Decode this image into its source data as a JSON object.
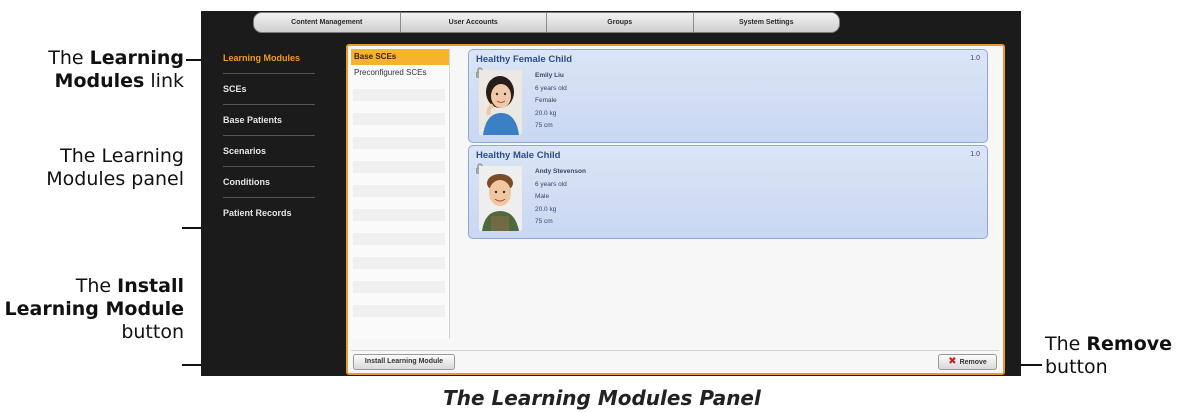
{
  "callouts": {
    "learning_modules_link": {
      "pre": "The ",
      "bold": "Learning Modules",
      "post": " link"
    },
    "learning_modules_panel": {
      "line1": "The Learning",
      "line2": "Modules panel"
    },
    "install_button": {
      "pre": "The ",
      "bold": "Install Learning Module",
      "post": " button"
    },
    "remove_button": {
      "pre": "The ",
      "bold": "Remove",
      "post": "button"
    }
  },
  "caption": "The Learning Modules Panel",
  "app": {
    "tabs": [
      "Content Management",
      "User Accounts",
      "Groups",
      "System Settings"
    ],
    "sidebar": {
      "items": [
        {
          "label": "Learning Modules",
          "active": true
        },
        {
          "label": "SCEs",
          "active": false
        },
        {
          "label": "Base Patients",
          "active": false
        },
        {
          "label": "Scenarios",
          "active": false
        },
        {
          "label": "Conditions",
          "active": false
        },
        {
          "label": "Patient Records",
          "active": false
        }
      ]
    },
    "module_list": {
      "items": [
        {
          "label": "Base SCEs",
          "selected": true
        },
        {
          "label": "Preconfigured SCEs",
          "selected": false
        }
      ]
    },
    "cards": [
      {
        "title": "Healthy Female Child",
        "version": "1.0",
        "name": "Emily Liu",
        "age": "6 years old",
        "sex": "Female",
        "weight": "20.0 kg",
        "height": "75 cm"
      },
      {
        "title": "Healthy Male Child",
        "version": "1.0",
        "name": "Andy Stevenson",
        "age": "6 years old",
        "sex": "Male",
        "weight": "20.0 kg",
        "height": "75 cm"
      }
    ],
    "buttons": {
      "install": "Install Learning Module",
      "remove": "Remove"
    },
    "colors": {
      "accent_orange": "#f29d1c",
      "card_title_blue": "#2b4f86",
      "remove_red": "#d21f1f"
    }
  }
}
